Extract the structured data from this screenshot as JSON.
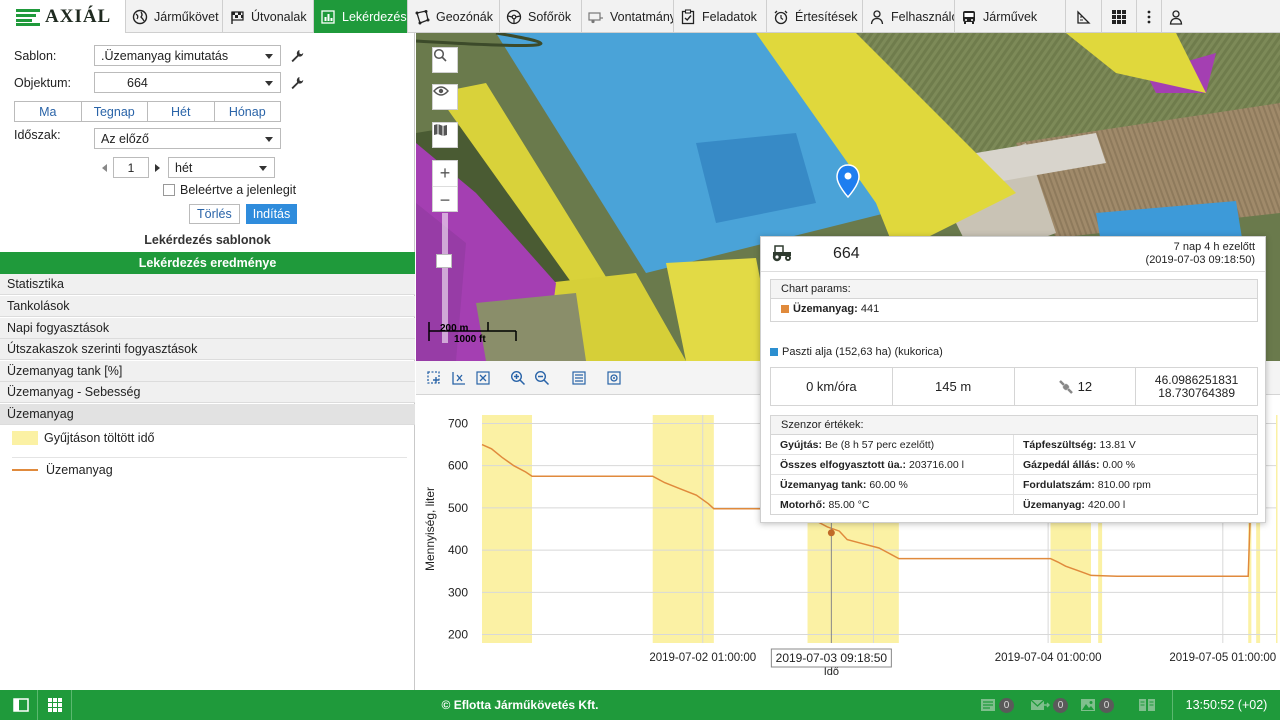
{
  "app": {
    "logo_text": "AXIÁL"
  },
  "nav": {
    "tabs": [
      {
        "label": "Járműkövet",
        "icon": "globe-icon"
      },
      {
        "label": "Útvonalak",
        "icon": "checkered-flag-icon"
      },
      {
        "label": "Lekérdezés",
        "icon": "report-chart-icon",
        "active": true
      },
      {
        "label": "Geozónák",
        "icon": "polygon-icon"
      },
      {
        "label": "Sofőrök",
        "icon": "steering-wheel-icon"
      },
      {
        "label": "Vontatmány",
        "icon": "trailer-icon"
      },
      {
        "label": "Feladatok",
        "icon": "task-check-icon"
      },
      {
        "label": "Értesítések",
        "icon": "alarm-clock-icon"
      },
      {
        "label": "Felhasználó",
        "icon": "user-icon"
      },
      {
        "label": "Járművek",
        "icon": "bus-icon"
      }
    ],
    "extra_icons": [
      "ruler-icon",
      "grid-menu-icon",
      "more-vertical-icon",
      "account-icon"
    ]
  },
  "query": {
    "sablon_label": "Sablon:",
    "sablon_value": ".Üzemanyag kimutatás",
    "objektum_label": "Objektum:",
    "objektum_value": "664",
    "quick_ranges": [
      "Ma",
      "Tegnap",
      "Hét",
      "Hónap"
    ],
    "idoszak_label": "Időszak:",
    "idoszak_value": "Az előző",
    "count_value": "1",
    "unit_value": "hét",
    "include_current_label": "Beleértve a jelenlegit",
    "clear_label": "Törlés",
    "start_label": "Indítás",
    "templates_title": "Lekérdezés sablonok",
    "results_title": "Lekérdezés eredménye",
    "result_items": [
      "Statisztika",
      "Tankolások",
      "Napi fogyasztások",
      "Útszakaszok szerinti fogyasztások",
      "Üzemanyag tank [%]",
      "Üzemanyag - Sebesség",
      "Üzemanyag"
    ],
    "legend_collect": "Gyűjtáson töltött idő",
    "legend_fuel": "Üzemanyag"
  },
  "map": {
    "scale_m": "200 m",
    "scale_ft": "1000 ft",
    "colors": {
      "blue_zone": "#3d9ad9",
      "yellow_zone": "#e6dc3a",
      "purple_zone": "#a83cb4"
    }
  },
  "popup": {
    "vehicle_id": "664",
    "ago": "7 nap 4 h ezelőtt",
    "timestamp": "(2019-07-03 09:18:50)",
    "chart_params_title": "Chart params:",
    "param_label": "Üzemanyag:",
    "param_value": "441",
    "zone_text": "Paszti alja (152,63 ha) (kukorica)",
    "speed": "0 km/óra",
    "altitude": "145 m",
    "satellites": "12",
    "lat": "46.0986251831",
    "lon": "18.730764389",
    "sensor_title": "Szenzor értékek:",
    "sensors": [
      {
        "k": "Gyújtás:",
        "v": "Be (8 h 57 perc ezelőtt)"
      },
      {
        "k": "Tápfeszültség:",
        "v": "13.81 V"
      },
      {
        "k": "Összes elfogyasztott üa.:",
        "v": "203716.00 l"
      },
      {
        "k": "Gázpedál állás:",
        "v": "0.00 %"
      },
      {
        "k": "Üzemanyag tank:",
        "v": "60.00 %"
      },
      {
        "k": "Fordulatszám:",
        "v": "810.00 rpm"
      },
      {
        "k": "Motorhő:",
        "v": "85.00 °C"
      },
      {
        "k": "Üzemanyag:",
        "v": "420.00 l"
      }
    ],
    "colors": {
      "param_square": "#e08a3c",
      "zone_square": "#2c8fd0"
    }
  },
  "chart_data": {
    "type": "line",
    "ylabel": "Mennyiség, liter",
    "xlabel": "Idő",
    "ylim": [
      180,
      720
    ],
    "yticks": [
      200,
      300,
      400,
      500,
      600,
      700
    ],
    "xticks": [
      "2019-07-02 01:00:00",
      "2019-07-0",
      "2019-07-04 01:00:00",
      "2019-07-05 01:00:00"
    ],
    "cursor_label": "2019-07-03 09:18:50",
    "xlim": [
      0,
      100
    ],
    "collect_bands": [
      [
        0,
        6.3
      ],
      [
        21.5,
        29.2
      ],
      [
        41,
        52.5
      ],
      [
        71.6,
        76.7
      ],
      [
        77.6,
        78.1
      ],
      [
        96.5,
        96.9
      ],
      [
        97.5,
        98
      ],
      [
        100,
        100
      ]
    ],
    "series": [
      {
        "name": "Üzemanyag",
        "color": "#e08a3c",
        "x": [
          0,
          1.2,
          2.5,
          4,
          5.5,
          6.3,
          10,
          21.5,
          23,
          25,
          27,
          28.5,
          29.2,
          40,
          41,
          42,
          43.5,
          45,
          46,
          48,
          50,
          51.5,
          52.5,
          63,
          71.6,
          72.5,
          73.5,
          75,
          76,
          76.7,
          80,
          90,
          96.5,
          96.8,
          97.2
        ],
        "values": [
          650,
          640,
          620,
          600,
          585,
          575,
          575,
          575,
          560,
          545,
          530,
          510,
          498,
          498,
          480,
          470,
          455,
          445,
          425,
          415,
          405,
          390,
          380,
          380,
          380,
          372,
          362,
          352,
          345,
          340,
          338,
          338,
          338,
          510,
          560
        ]
      }
    ],
    "cursor_x": 44,
    "cursor_value": 441
  },
  "footer": {
    "company": "© Eflotta Járműkövetés Kft.",
    "badges": [
      "0",
      "0",
      "0",
      "0"
    ],
    "clock": "13:50:52 (+02)"
  }
}
